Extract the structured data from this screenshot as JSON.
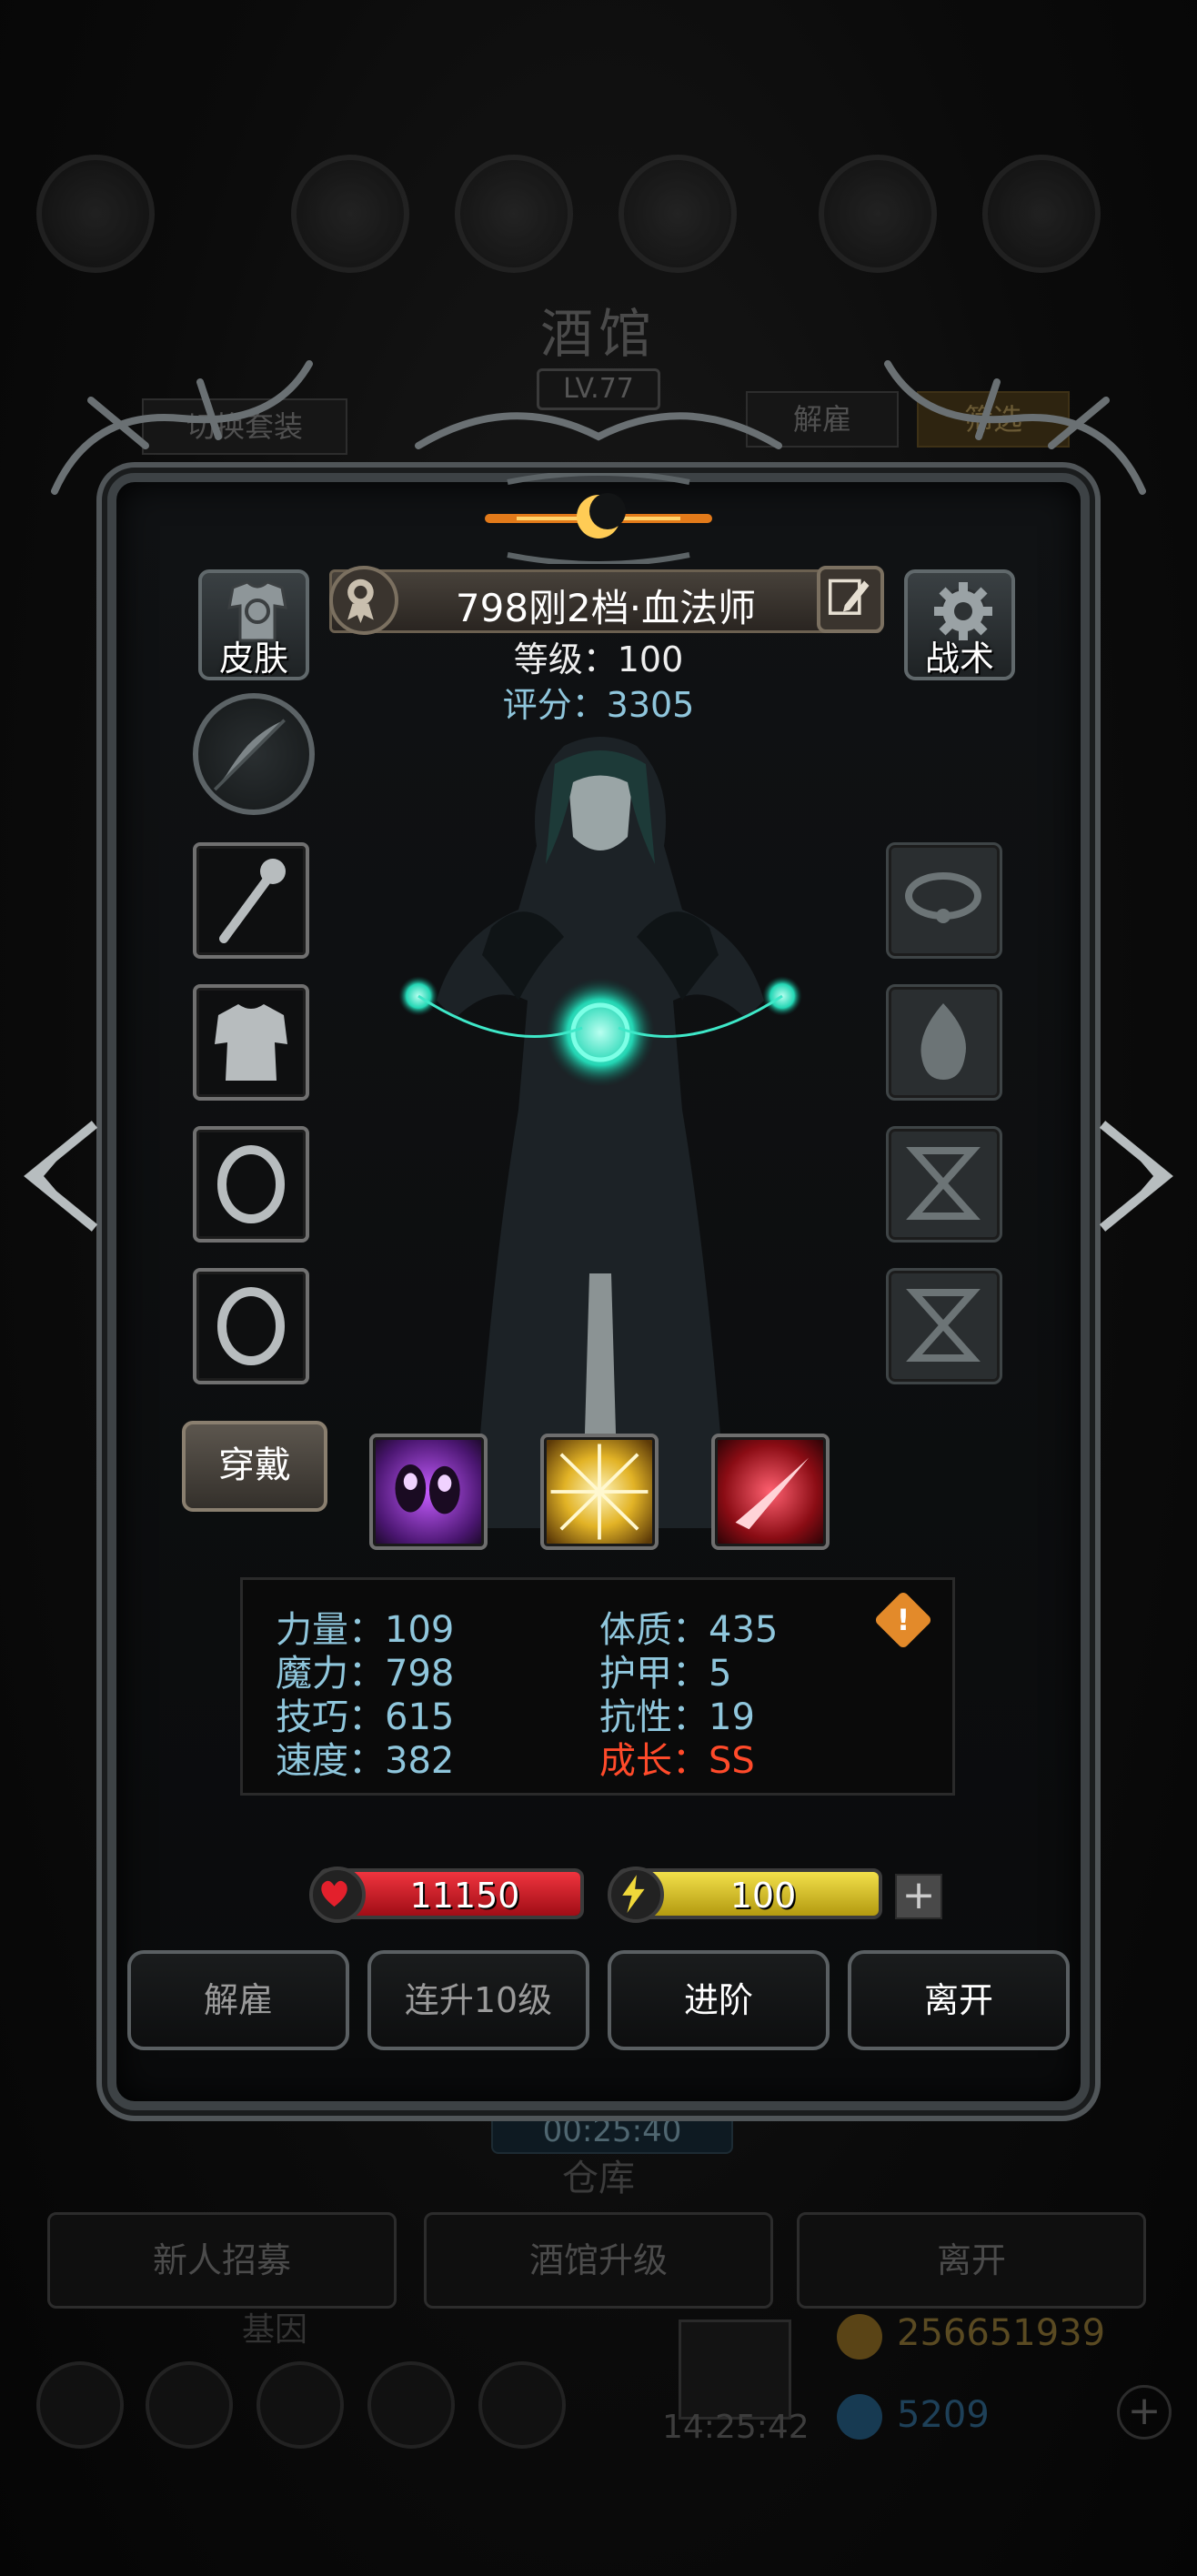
{
  "background": {
    "title": "酒馆",
    "level": "LV.77",
    "switch_outfit": "切换套装",
    "dismiss_tab": "解雇",
    "filter_tab": "筛选",
    "timer": "00:25:40",
    "warehouse": "仓库",
    "recruit": "新人招募",
    "upgrade_tavern": "酒馆升级",
    "leave": "离开",
    "stone": "基因",
    "clock": "14:25:42",
    "gold": "256651939",
    "gems": "5209",
    "plus": "+"
  },
  "hero": {
    "name": "798刚2档·血法师",
    "level_text": "等级：100",
    "score_text": "评分：3305",
    "skin_label": "皮肤",
    "tactics_label": "战术",
    "wear_label": "穿戴"
  },
  "stats": {
    "strength": "力量：109",
    "magic": "魔力：798",
    "skill": "技巧：615",
    "speed": "速度：382",
    "constitution": "体质：435",
    "armor": "护甲：5",
    "resistance": "抗性：19",
    "growth": "成长：SS",
    "warning": "!"
  },
  "bars": {
    "hp": "11150",
    "energy": "100",
    "plus": "+"
  },
  "actions": {
    "dismiss": "解雇",
    "level_up_10": "连升10级",
    "advance": "进阶",
    "leave": "离开"
  },
  "colors": {
    "score": "#8fc6dc",
    "growth": "#ff4a2a",
    "hp_bar": "#d01822",
    "energy_bar": "#d9c21a",
    "warning": "#e38a2a"
  }
}
